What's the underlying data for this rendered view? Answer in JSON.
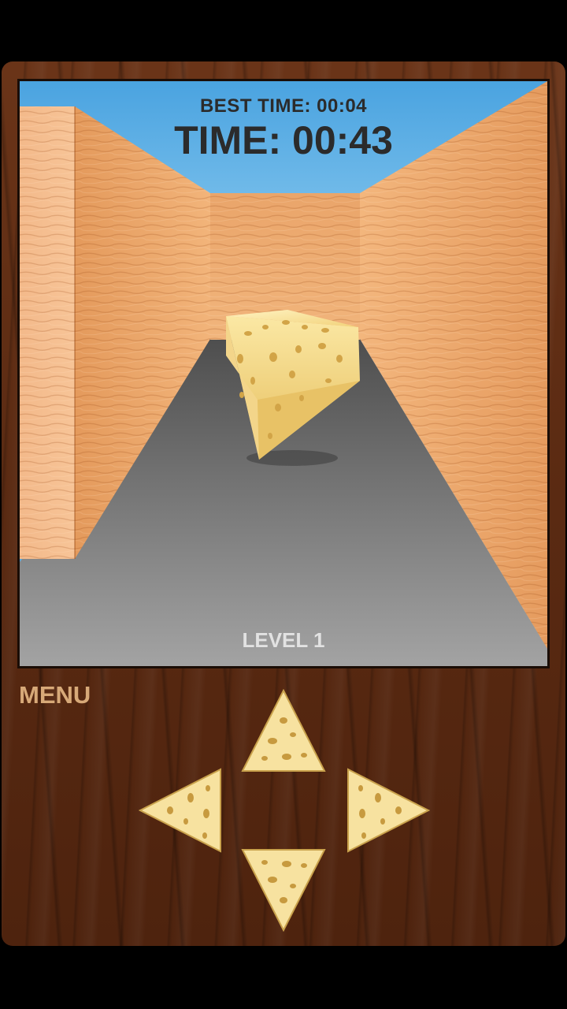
{
  "hud": {
    "best_time": "BEST TIME: 00:04",
    "time": "TIME: 00:43",
    "level": "LEVEL 1"
  },
  "menu": {
    "label": "MENU"
  },
  "controls": {
    "up": "cheese-up-arrow-icon",
    "down": "cheese-down-arrow-icon",
    "left": "cheese-left-arrow-icon",
    "right": "cheese-right-arrow-icon"
  },
  "colors": {
    "sky": "#5aa9dc",
    "wood_wall": "#e8a66a",
    "floor": "#707070",
    "cheese": "#f6dc8a",
    "cabinet_wood": "#5a2a12",
    "menu_text": "#d7a978"
  }
}
